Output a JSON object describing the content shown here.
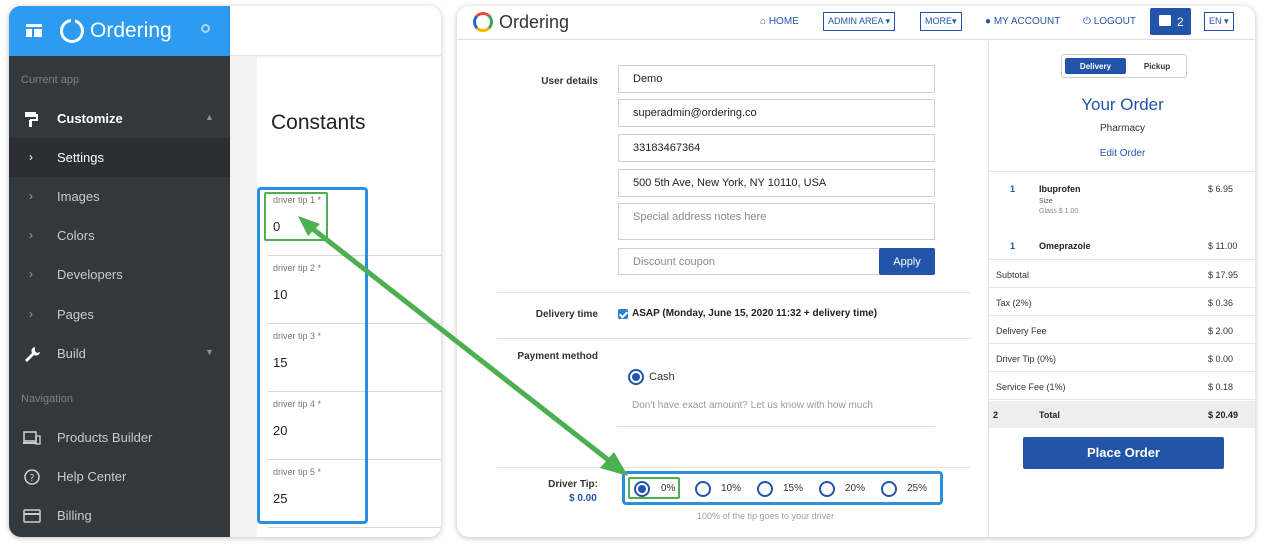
{
  "sidebar": {
    "brand": "Ordering",
    "section_current_app": "Current app",
    "section_navigation": "Navigation",
    "customize": "Customize",
    "settings": "Settings",
    "images": "Images",
    "colors": "Colors",
    "developers": "Developers",
    "pages": "Pages",
    "build": "Build",
    "products_builder": "Products Builder",
    "help_center": "Help Center",
    "billing": "Billing"
  },
  "constants": {
    "title": "Constants",
    "tips": [
      {
        "label": "driver tip 1 *",
        "value": "0"
      },
      {
        "label": "driver tip 2 *",
        "value": "10"
      },
      {
        "label": "driver tip 3 *",
        "value": "15"
      },
      {
        "label": "driver tip 4 *",
        "value": "20"
      },
      {
        "label": "driver tip 5 *",
        "value": "25"
      }
    ]
  },
  "topnav": {
    "brand": "Ordering",
    "home": "HOME",
    "admin_area": "ADMIN AREA",
    "more": "MORE",
    "my_account": "MY ACCOUNT",
    "logout": "LOGOUT",
    "cart_count": "2",
    "lang": "EN"
  },
  "checkout": {
    "user_details_label": "User details",
    "name": "Demo",
    "email": "superadmin@ordering.co",
    "phone": "33183467364",
    "address": "500 5th Ave, New York, NY 10110, USA",
    "address_notes_placeholder": "Special address notes here",
    "discount_placeholder": "Discount coupon",
    "apply": "Apply",
    "delivery_time_label": "Delivery time",
    "delivery_time_value": "ASAP (Monday, June 15, 2020 11:32 + delivery time)",
    "payment_method_label": "Payment method",
    "cash": "Cash",
    "cash_note": "Don't have exact amount? Let us know with how much",
    "driver_tip_label": "Driver Tip:",
    "driver_tip_amount": "$ 0.00",
    "tip_options": [
      "0%",
      "10%",
      "15%",
      "20%",
      "25%"
    ],
    "tip_selected": 0,
    "tip_note": "100% of the tip goes to your driver"
  },
  "cart": {
    "delivery": "Delivery",
    "pickup": "Pickup",
    "title": "Your Order",
    "store": "Pharmacy",
    "edit_order": "Edit Order",
    "items": [
      {
        "qty": "1",
        "name": "Ibuprofen",
        "option_group": "Size",
        "option": "Glass  $ 1.00",
        "price": "$ 6.95"
      },
      {
        "qty": "1",
        "name": "Omeprazole",
        "price": "$ 11.00"
      }
    ],
    "summary": [
      {
        "label": "Subtotal",
        "value": "$ 17.95"
      },
      {
        "label": "Tax (2%)",
        "value": "$ 0.36"
      },
      {
        "label": "Delivery Fee",
        "value": "$ 2.00"
      },
      {
        "label": "Driver Tip (0%)",
        "value": "$ 0.00"
      },
      {
        "label": "Service Fee (1%)",
        "value": "$ 0.18"
      }
    ],
    "total_qty": "2",
    "total_label": "Total",
    "total_value": "$ 20.49",
    "place_order": "Place Order"
  },
  "colors": {
    "brand_blue": "#2255aa",
    "sidebar_bg": "#33383d",
    "sidebar_header": "#2d9bf0",
    "annotation_blue": "#2b8fe0",
    "annotation_green": "#4caf50"
  }
}
